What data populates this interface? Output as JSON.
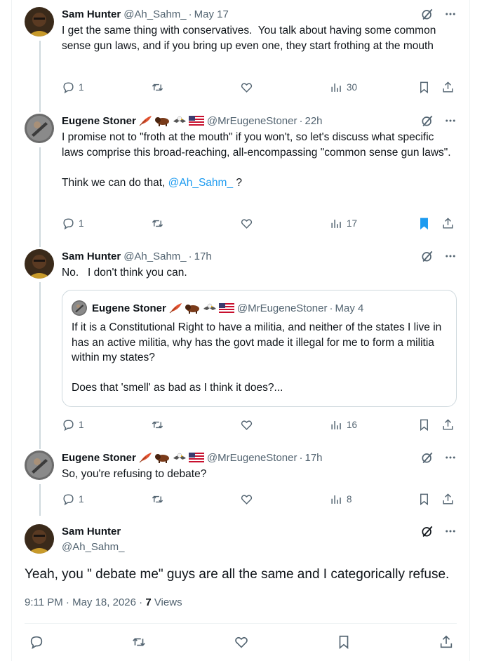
{
  "posts": [
    {
      "name": "Sam Hunter",
      "handle": "@Ah_Sahm_",
      "time": "May 17",
      "text": "I get the same thing with conservatives.  You talk about having some common sense gun laws, and if you bring up even one, they start frothing at the mouth",
      "replies": "1",
      "views": "30"
    },
    {
      "name": "Eugene Stoner",
      "handle": "@MrEugeneStoner",
      "time": "22h",
      "text": "I promise not to \"froth at the mouth\" if you won't, so let's discuss what specific laws comprise this broad-reaching, all-encompassing \"common sense gun laws\".\n\nThink we can do that, ",
      "mention": "@Ah_Sahm_",
      "text_tail": " ?",
      "replies": "1",
      "views": "17"
    },
    {
      "name": "Sam Hunter",
      "handle": "@Ah_Sahm_",
      "time": "17h",
      "text": "No.   I don't think you can.",
      "replies": "1",
      "views": "16",
      "quote": {
        "name": "Eugene Stoner",
        "handle": "@MrEugeneStoner",
        "time": "May 4",
        "text": "If it is a Constitutional Right to have a militia, and neither of the states I live in has an active militia, why has the govt made it illegal for me to form a militia within my states?\n\nDoes that 'smell' as bad as I think it does?..."
      }
    },
    {
      "name": "Eugene Stoner",
      "handle": "@MrEugeneStoner",
      "time": "17h",
      "text": "So, you're refusing to debate?",
      "replies": "1",
      "views": "8"
    }
  ],
  "focused": {
    "name": "Sam Hunter",
    "handle": "@Ah_Sahm_",
    "text": "Yeah, you \" debate me\" guys are all the same and I categorically refuse.",
    "timestamp": "9:11 PM · May 18, 2026 · ",
    "views_count": "7",
    "views_label": " Views"
  },
  "separator": "·",
  "colors": {
    "accent": "#1d9bf0",
    "secondary_text": "#536471",
    "border": "#cfd9de"
  },
  "icons": [
    "reply-icon",
    "repost-icon",
    "like-icon",
    "views-icon",
    "bookmark-icon",
    "share-icon",
    "grok-icon",
    "more-icon"
  ]
}
